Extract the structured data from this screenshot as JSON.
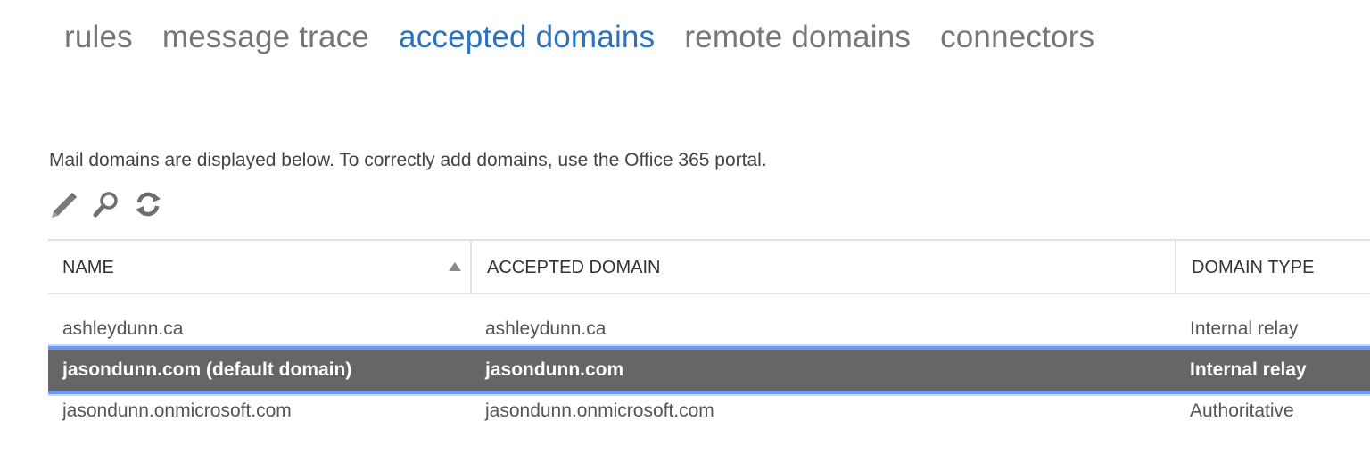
{
  "tabs": [
    {
      "label": "rules",
      "active": false
    },
    {
      "label": "message trace",
      "active": false
    },
    {
      "label": "accepted domains",
      "active": true
    },
    {
      "label": "remote domains",
      "active": false
    },
    {
      "label": "connectors",
      "active": false
    }
  ],
  "description": "Mail domains are displayed below. To correctly add domains, use the Office 365 portal.",
  "toolbar": {
    "icons": [
      "pencil-icon",
      "search-icon",
      "refresh-icon"
    ]
  },
  "table": {
    "columns": [
      "NAME",
      "ACCEPTED DOMAIN",
      "DOMAIN TYPE"
    ],
    "sort": {
      "column": "NAME",
      "direction": "ascending"
    },
    "rows": [
      {
        "name": "ashleydunn.ca",
        "accepted_domain": "ashleydunn.ca",
        "domain_type": "Internal relay",
        "selected": false
      },
      {
        "name": "jasondunn.com (default domain)",
        "accepted_domain": "jasondunn.com",
        "domain_type": "Internal relay",
        "selected": true
      },
      {
        "name": "jasondunn.onmicrosoft.com",
        "accepted_domain": "jasondunn.onmicrosoft.com",
        "domain_type": "Authoritative",
        "selected": false
      }
    ]
  },
  "colors": {
    "active_tab": "#2b73c2",
    "inactive_tab": "#777777",
    "selected_row_bg": "#666666",
    "selection_outline": "#6a9cf5"
  }
}
